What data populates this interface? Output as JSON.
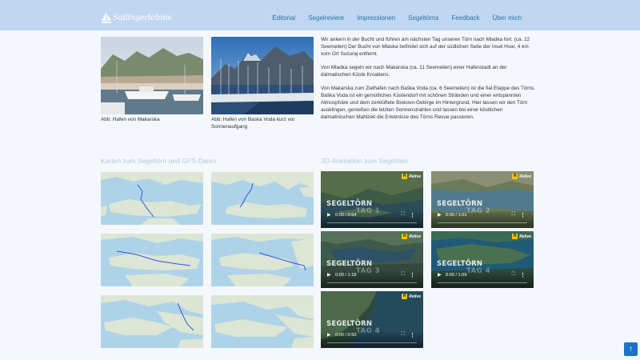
{
  "brand": {
    "logo_text": "Sailingerlebnis"
  },
  "nav": {
    "items": [
      "Editorial",
      "Segelreviere",
      "Impressionen",
      "Segeltörns",
      "Feedback",
      "Über mich"
    ]
  },
  "photos": [
    {
      "caption": "Abb: Hafen von Makarska"
    },
    {
      "caption": "Abb: Hafen von Baska Voda kurz vor Sonnenaufgang"
    }
  ],
  "text": {
    "p1": "Wir ankern in der Bucht und führen am nächsten Tag unseren Törn nach Mladka fort. (ca. 22 Seemeilen) Der Bucht von Mlaska befindet sich auf der südlichen Seite der Insel Hvar, 4 km vom Ort Sućuraj entfernt.",
    "p2": "Von Mladka segeln wir nach Makarska (ca. 11 Seemeilen) einer Hafenstadt an der dalmatischen Küste Kroatiens.",
    "p3": "Von Makarska zum Zielhafen nach Baška Voda (ca. 6 Seemeilen) ist die fial Etappe des Törns. Baška Voda ist ein gemütliches Küstendorf mit schönen Stränden und einer entspannten Atmosphäre und dem zerklüftete Biokovo-Gebirge im Hintergrund. Hier lassen wir den Törn ausklingen, genießen die letzten Sonnenstrahlen und lassen bei einer köstlichen dalmatinischen Mahlzeit die Erlebnisse des Törns Revue passieren."
  },
  "sections": {
    "maps_title": "Karten zum Segeltörn und GPS-Daten",
    "anim_title": "3D-Animation zum Segeltörn"
  },
  "videos": [
    {
      "title": "SEGELTÖRN",
      "subtitle": "TAG 1",
      "time": "0:00 / 0:54"
    },
    {
      "title": "SEGELTÖRN",
      "subtitle": "TAG 2",
      "time": "0:00 / 1:01"
    },
    {
      "title": "SEGELTÖRN",
      "subtitle": "TAG 3",
      "time": "0:00 / 1:18"
    },
    {
      "title": "SEGELTÖRN",
      "subtitle": "TAG 4",
      "time": "0:00 / 1:09"
    },
    {
      "title": "SEGELTÖRN",
      "subtitle": "TAG 4",
      "time": "0:00 / 0:50"
    }
  ],
  "video_badge": "Relive",
  "icons": {
    "play": "play-icon",
    "fullscreen": "fullscreen-icon",
    "more": "more-vertical-icon",
    "top": "arrow-up-icon",
    "logo": "sailboat-icon"
  },
  "colors": {
    "nav_bg": "#bfd7f1",
    "nav_link": "#2f6fa8",
    "accent": "#1a73c8",
    "section_title": "#b5c6d8"
  }
}
